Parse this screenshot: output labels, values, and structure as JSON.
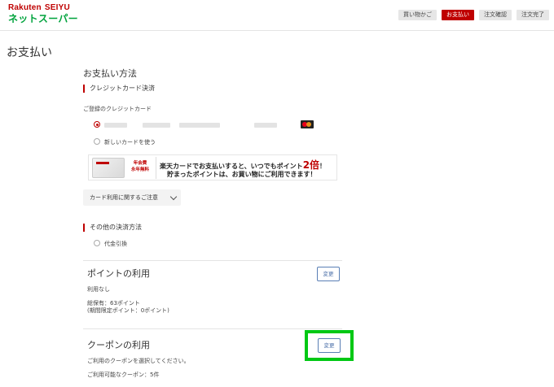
{
  "header": {
    "logo_line1a": "Rakuten",
    "logo_line1b": "SEIYU",
    "logo_line2": "ネットスーパー",
    "steps": [
      {
        "label": "買い物かご",
        "active": false
      },
      {
        "label": "お支払い",
        "active": true
      },
      {
        "label": "注文確認",
        "active": false
      },
      {
        "label": "注文完了",
        "active": false
      }
    ]
  },
  "page": {
    "title": "お支払い"
  },
  "payment_method": {
    "title": "お支払い方法",
    "credit_head": "クレジットカード決済",
    "registered_label": "ご登録のクレジットカード",
    "new_card_label": "新しいカードを使う",
    "banner": {
      "fee_line1": "年会費",
      "fee_line2": "永年無料",
      "line1_pre": "楽天カードでお支払いすると、いつでもポイント",
      "line1_big": "2倍",
      "line1_post": "！",
      "line2": "貯まったポイントは、お買い物にご利用できます！"
    },
    "notice_dropdown": "カード利用に関するご注意",
    "other_head": "その他の決済方法",
    "cod_label": "代金引換"
  },
  "points": {
    "title": "ポイントの利用",
    "status": "利用なし",
    "owned": "総保有：63ポイント",
    "limited": "(期間限定ポイント：0ポイント)",
    "change_label": "変更"
  },
  "coupon": {
    "title": "クーポンの利用",
    "instruction": "ご利用のクーポンを選択してください。",
    "available": "ご利用可能なクーポン：5件",
    "change_label": "変更"
  },
  "colors": {
    "brand_red": "#bf0000",
    "brand_green": "#00a33d",
    "highlight_green": "#00c814",
    "button_blue": "#4b6fa8"
  }
}
